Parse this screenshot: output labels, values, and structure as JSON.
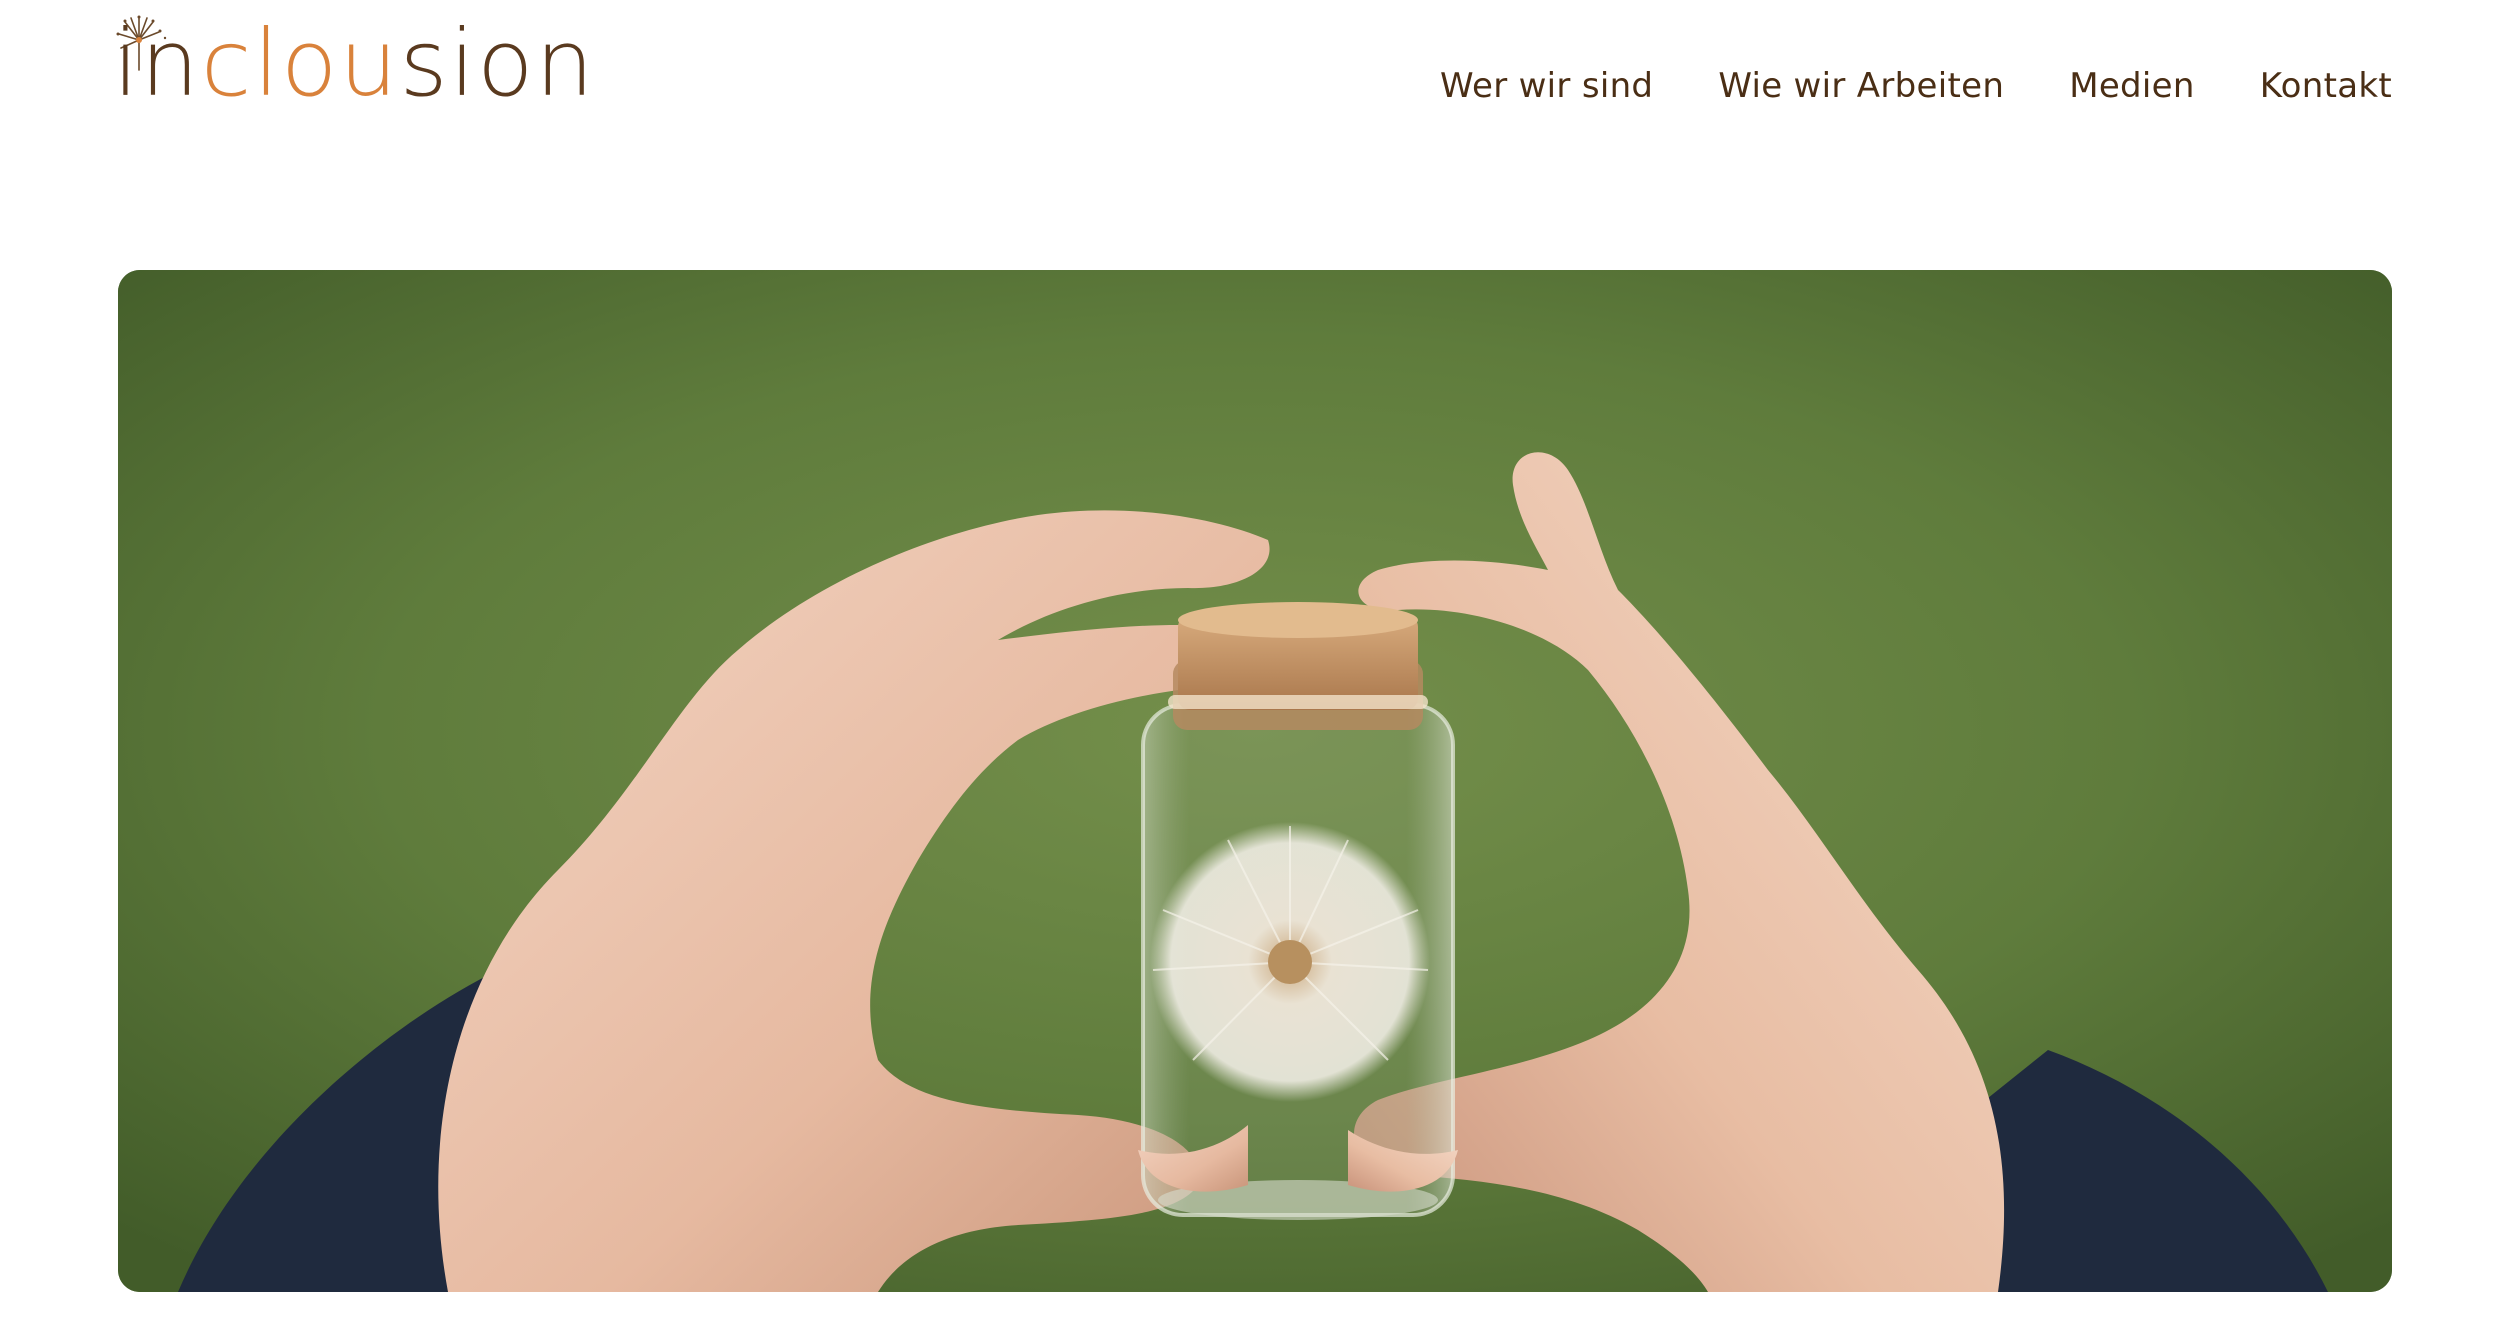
{
  "brand": {
    "logo_part1": "in",
    "logo_part2": "clou",
    "logo_part3": "sion",
    "colors": {
      "brown": "#5a3a1f",
      "orange": "#d9823b"
    }
  },
  "nav": {
    "items": [
      {
        "label": "Wer wir sind"
      },
      {
        "label": "Wie wir Arbeiten"
      },
      {
        "label": "Medien"
      },
      {
        "label": "Kontakt"
      }
    ],
    "color": "#4a2e15"
  },
  "hero": {
    "image_icon": "dandelion-in-jar-photo"
  }
}
